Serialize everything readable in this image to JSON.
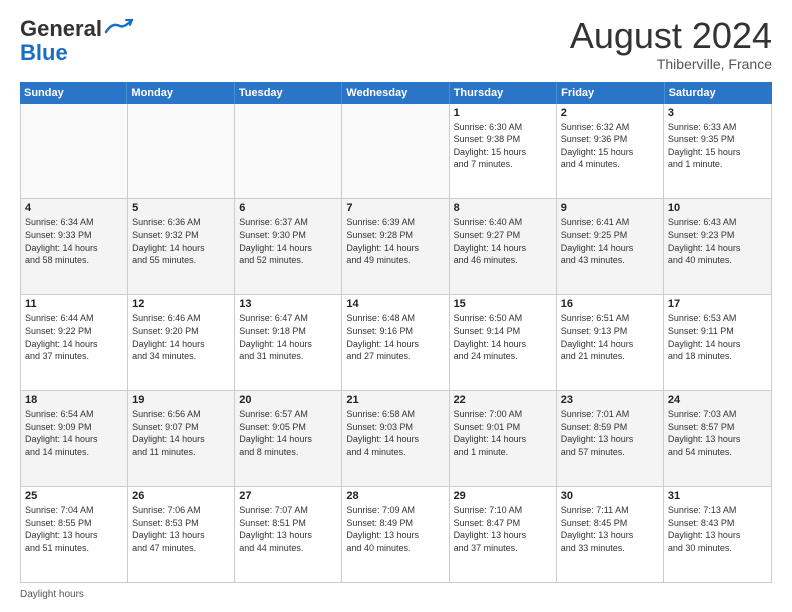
{
  "header": {
    "logo_general": "General",
    "logo_blue": "Blue",
    "month_title": "August 2024",
    "location": "Thiberville, France"
  },
  "days_of_week": [
    "Sunday",
    "Monday",
    "Tuesday",
    "Wednesday",
    "Thursday",
    "Friday",
    "Saturday"
  ],
  "footer": {
    "daylight_label": "Daylight hours"
  },
  "weeks": [
    [
      {
        "day": "",
        "info": "",
        "empty": true
      },
      {
        "day": "",
        "info": "",
        "empty": true
      },
      {
        "day": "",
        "info": "",
        "empty": true
      },
      {
        "day": "",
        "info": "",
        "empty": true
      },
      {
        "day": "1",
        "info": "Sunrise: 6:30 AM\nSunset: 9:38 PM\nDaylight: 15 hours\nand 7 minutes."
      },
      {
        "day": "2",
        "info": "Sunrise: 6:32 AM\nSunset: 9:36 PM\nDaylight: 15 hours\nand 4 minutes."
      },
      {
        "day": "3",
        "info": "Sunrise: 6:33 AM\nSunset: 9:35 PM\nDaylight: 15 hours\nand 1 minute."
      }
    ],
    [
      {
        "day": "4",
        "info": "Sunrise: 6:34 AM\nSunset: 9:33 PM\nDaylight: 14 hours\nand 58 minutes."
      },
      {
        "day": "5",
        "info": "Sunrise: 6:36 AM\nSunset: 9:32 PM\nDaylight: 14 hours\nand 55 minutes."
      },
      {
        "day": "6",
        "info": "Sunrise: 6:37 AM\nSunset: 9:30 PM\nDaylight: 14 hours\nand 52 minutes."
      },
      {
        "day": "7",
        "info": "Sunrise: 6:39 AM\nSunset: 9:28 PM\nDaylight: 14 hours\nand 49 minutes."
      },
      {
        "day": "8",
        "info": "Sunrise: 6:40 AM\nSunset: 9:27 PM\nDaylight: 14 hours\nand 46 minutes."
      },
      {
        "day": "9",
        "info": "Sunrise: 6:41 AM\nSunset: 9:25 PM\nDaylight: 14 hours\nand 43 minutes."
      },
      {
        "day": "10",
        "info": "Sunrise: 6:43 AM\nSunset: 9:23 PM\nDaylight: 14 hours\nand 40 minutes."
      }
    ],
    [
      {
        "day": "11",
        "info": "Sunrise: 6:44 AM\nSunset: 9:22 PM\nDaylight: 14 hours\nand 37 minutes."
      },
      {
        "day": "12",
        "info": "Sunrise: 6:46 AM\nSunset: 9:20 PM\nDaylight: 14 hours\nand 34 minutes."
      },
      {
        "day": "13",
        "info": "Sunrise: 6:47 AM\nSunset: 9:18 PM\nDaylight: 14 hours\nand 31 minutes."
      },
      {
        "day": "14",
        "info": "Sunrise: 6:48 AM\nSunset: 9:16 PM\nDaylight: 14 hours\nand 27 minutes."
      },
      {
        "day": "15",
        "info": "Sunrise: 6:50 AM\nSunset: 9:14 PM\nDaylight: 14 hours\nand 24 minutes."
      },
      {
        "day": "16",
        "info": "Sunrise: 6:51 AM\nSunset: 9:13 PM\nDaylight: 14 hours\nand 21 minutes."
      },
      {
        "day": "17",
        "info": "Sunrise: 6:53 AM\nSunset: 9:11 PM\nDaylight: 14 hours\nand 18 minutes."
      }
    ],
    [
      {
        "day": "18",
        "info": "Sunrise: 6:54 AM\nSunset: 9:09 PM\nDaylight: 14 hours\nand 14 minutes."
      },
      {
        "day": "19",
        "info": "Sunrise: 6:56 AM\nSunset: 9:07 PM\nDaylight: 14 hours\nand 11 minutes."
      },
      {
        "day": "20",
        "info": "Sunrise: 6:57 AM\nSunset: 9:05 PM\nDaylight: 14 hours\nand 8 minutes."
      },
      {
        "day": "21",
        "info": "Sunrise: 6:58 AM\nSunset: 9:03 PM\nDaylight: 14 hours\nand 4 minutes."
      },
      {
        "day": "22",
        "info": "Sunrise: 7:00 AM\nSunset: 9:01 PM\nDaylight: 14 hours\nand 1 minute."
      },
      {
        "day": "23",
        "info": "Sunrise: 7:01 AM\nSunset: 8:59 PM\nDaylight: 13 hours\nand 57 minutes."
      },
      {
        "day": "24",
        "info": "Sunrise: 7:03 AM\nSunset: 8:57 PM\nDaylight: 13 hours\nand 54 minutes."
      }
    ],
    [
      {
        "day": "25",
        "info": "Sunrise: 7:04 AM\nSunset: 8:55 PM\nDaylight: 13 hours\nand 51 minutes."
      },
      {
        "day": "26",
        "info": "Sunrise: 7:06 AM\nSunset: 8:53 PM\nDaylight: 13 hours\nand 47 minutes."
      },
      {
        "day": "27",
        "info": "Sunrise: 7:07 AM\nSunset: 8:51 PM\nDaylight: 13 hours\nand 44 minutes."
      },
      {
        "day": "28",
        "info": "Sunrise: 7:09 AM\nSunset: 8:49 PM\nDaylight: 13 hours\nand 40 minutes."
      },
      {
        "day": "29",
        "info": "Sunrise: 7:10 AM\nSunset: 8:47 PM\nDaylight: 13 hours\nand 37 minutes."
      },
      {
        "day": "30",
        "info": "Sunrise: 7:11 AM\nSunset: 8:45 PM\nDaylight: 13 hours\nand 33 minutes."
      },
      {
        "day": "31",
        "info": "Sunrise: 7:13 AM\nSunset: 8:43 PM\nDaylight: 13 hours\nand 30 minutes."
      }
    ]
  ]
}
